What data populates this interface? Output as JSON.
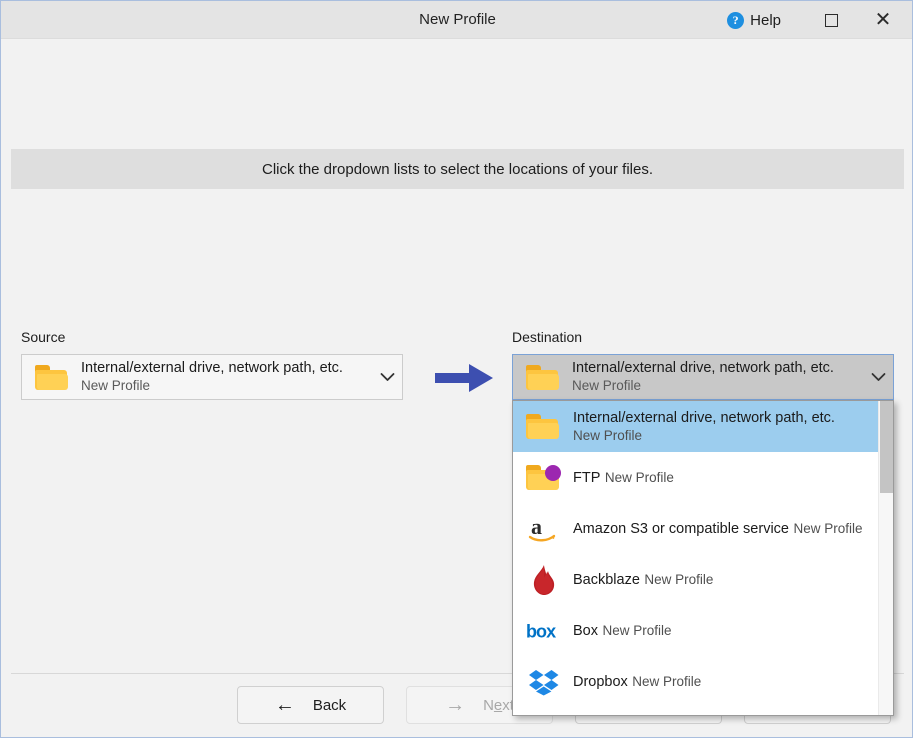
{
  "window": {
    "title": "New Profile",
    "help_label": "Help",
    "maximize_icon": "maximize-icon",
    "close_icon": "close-icon",
    "help_icon": "help-circle-icon"
  },
  "banner": {
    "text": "Click the dropdown lists to select the locations of your files."
  },
  "source": {
    "label": "Source",
    "icon": "folder-icon",
    "title": "Internal/external drive, network path, etc.",
    "subtitle": "New Profile",
    "chevron": "chevron-down-icon"
  },
  "flow": {
    "arrow_icon": "arrow-right-icon",
    "arrow_color": "#3d4fb0"
  },
  "destination": {
    "label": "Destination",
    "icon": "folder-icon",
    "title": "Internal/external drive, network path, etc.",
    "subtitle": "New Profile",
    "chevron": "chevron-down-icon",
    "expanded": true
  },
  "dropdown": {
    "items": [
      {
        "icon": "folder-icon",
        "title": "Internal/external drive, network path, etc.",
        "subtitle": "New Profile",
        "selected": true
      },
      {
        "icon": "folder-network-icon",
        "title": "FTP",
        "subtitle": "New Profile",
        "selected": false
      },
      {
        "icon": "amazon-s3-icon",
        "title": "Amazon S3 or compatible service",
        "subtitle": "New Profile",
        "selected": false
      },
      {
        "icon": "backblaze-icon",
        "title": "Backblaze",
        "subtitle": "New Profile",
        "selected": false
      },
      {
        "icon": "box-icon",
        "title": "Box",
        "subtitle": "New Profile",
        "selected": false
      },
      {
        "icon": "dropbox-icon",
        "title": "Dropbox",
        "subtitle": "New Profile",
        "selected": false
      }
    ],
    "scrollbar": "vertical-scrollbar"
  },
  "footer": {
    "back_label": "Back",
    "next_label_before": "N",
    "next_label_mnemonic": "e",
    "next_label_after": "xt",
    "back_icon": "arrow-left-icon",
    "next_icon": "arrow-right-icon",
    "next_disabled": true
  },
  "colors": {
    "highlight": "#9ccdee",
    "folder_yellow": "#fdc53f",
    "accent_blue": "#3d4fb0",
    "help_blue": "#1e8fe0"
  }
}
